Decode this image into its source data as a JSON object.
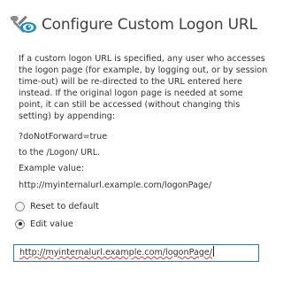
{
  "dialog": {
    "title": "Configure Custom Logon URL",
    "icon": "tools-eye-icon",
    "accent_color": "#1f8ad6"
  },
  "description": "If a custom logon URL is specified, any user who accesses the logon page (for example, by logging out, or by session time-out) will be re-directed to the URL entered here instead. If the original logon page is needed at some point, it can still be accessed (without changing this setting) by appending:",
  "query_param": "?doNotForward=true",
  "target_text": "to the /Logon/ URL.",
  "example_label": "Example value:",
  "example_value": "http://myinternalurl.example.com/logonPage/",
  "options": [
    {
      "label": "Reset to default",
      "checked": false
    },
    {
      "label": "Edit value",
      "checked": true
    }
  ],
  "url_input": {
    "value": "http://myinternalurl.example.com/logonPage/"
  }
}
